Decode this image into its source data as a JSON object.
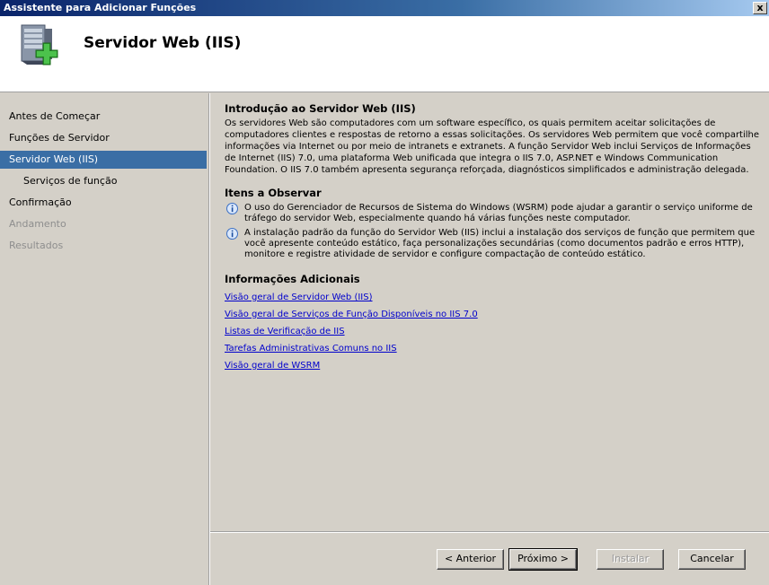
{
  "window": {
    "title": "Assistente para Adicionar Funções",
    "close_label": "x"
  },
  "header": {
    "title": "Servidor Web (IIS)",
    "icon": "server-add-icon"
  },
  "nav": {
    "items": [
      {
        "label": "Antes de Começar",
        "state": "normal"
      },
      {
        "label": "Funções de Servidor",
        "state": "normal"
      },
      {
        "label": "Servidor Web (IIS)",
        "state": "selected"
      },
      {
        "label": "Serviços de função",
        "state": "sub"
      },
      {
        "label": "Confirmação",
        "state": "normal"
      },
      {
        "label": "Andamento",
        "state": "disabled"
      },
      {
        "label": "Resultados",
        "state": "disabled"
      }
    ]
  },
  "content": {
    "intro_title": "Introdução ao Servidor Web (IIS)",
    "intro_text": "Os servidores Web são computadores com um software específico, os quais permitem aceitar solicitações de computadores clientes e respostas de retorno a essas solicitações. Os servidores Web permitem que você compartilhe informações via Internet ou por meio de intranets e extranets. A função Servidor Web inclui Serviços de Informações de Internet (IIS) 7.0, uma plataforma Web unificada que integra o IIS 7.0, ASP.NET e Windows Communication Foundation. O IIS 7.0 também apresenta segurança reforçada, diagnósticos simplificados e administração delegada.",
    "notes_title": "Itens a Observar",
    "notes": [
      "O uso do Gerenciador de Recursos de Sistema do Windows (WSRM) pode ajudar a garantir o serviço uniforme de tráfego do servidor Web, especialmente quando há várias funções neste computador.",
      "A instalação padrão da função do Servidor Web (IIS) inclui a instalação dos serviços de função que permitem que você apresente conteúdo estático, faça personalizações secundárias (como documentos padrão e erros HTTP), monitore e registre atividade de servidor e configure compactação de conteúdo estático."
    ],
    "links_title": "Informações Adicionais",
    "links": [
      "Visão geral de Servidor Web (IIS)",
      "Visão geral de Serviços de Função Disponíveis no IIS 7.0",
      "Listas de Verificação de IIS",
      "Tarefas Administrativas Comuns no IIS",
      "Visão geral de WSRM"
    ]
  },
  "footer": {
    "back_label": "< Anterior",
    "next_label": "Próximo >",
    "install_label": "Instalar",
    "cancel_label": "Cancelar"
  },
  "colors": {
    "selection": "#3a6ea5",
    "link": "#0000cc",
    "dialog_bg": "#d4d0c8"
  }
}
